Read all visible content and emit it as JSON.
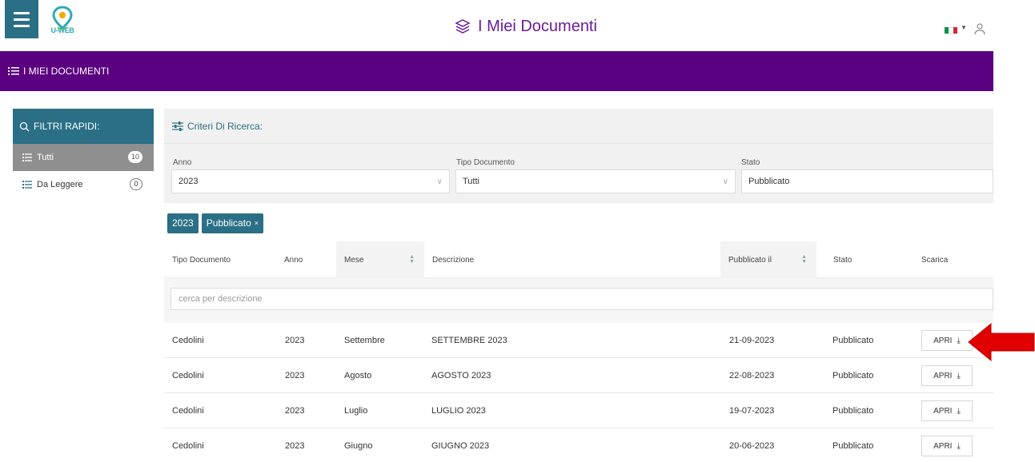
{
  "header": {
    "logo_text": "U-WEB",
    "title": "I Miei Documenti",
    "icons": [
      "menu-icon",
      "location-pin-icon",
      "layers-icon",
      "flag-italy-icon",
      "user-icon"
    ]
  },
  "band": {
    "label": "I MIEI DOCUMENTI"
  },
  "quick_filters": {
    "title": "FILTRI RAPIDI:",
    "items": [
      {
        "label": "Tutti",
        "count": "10"
      },
      {
        "label": "Da Leggere",
        "count": "0"
      }
    ]
  },
  "criteria": {
    "title": "Criteri Di Ricerca:",
    "anno": {
      "label": "Anno",
      "value": "2023"
    },
    "tipo": {
      "label": "Tipo Documento",
      "value": "Tutti"
    },
    "stato": {
      "label": "Stato",
      "value": "Pubblicato"
    }
  },
  "chips": [
    {
      "label": "2023"
    },
    {
      "label": "Pubblicato",
      "remove": "×"
    }
  ],
  "table": {
    "columns": [
      "Tipo Documento",
      "Anno",
      "Mese",
      "Descrizione",
      "Pubblicato il",
      "Stato",
      "Scarica"
    ],
    "search_placeholder": "cerca per descrizione",
    "rows": [
      {
        "tipo": "Cedolini",
        "anno": "2023",
        "mese": "Settembre",
        "descrizione": "SETTEMBRE 2023",
        "pubblicato": "21-09-2023",
        "stato": "Pubblicato",
        "azione": "APRI"
      },
      {
        "tipo": "Cedolini",
        "anno": "2023",
        "mese": "Agosto",
        "descrizione": "AGOSTO 2023",
        "pubblicato": "22-08-2023",
        "stato": "Pubblicato",
        "azione": "APRI"
      },
      {
        "tipo": "Cedolini",
        "anno": "2023",
        "mese": "Luglio",
        "descrizione": "LUGLIO 2023",
        "pubblicato": "19-07-2023",
        "stato": "Pubblicato",
        "azione": "APRI"
      },
      {
        "tipo": "Cedolini",
        "anno": "2023",
        "mese": "Giugno",
        "descrizione": "GIUGNO 2023",
        "pubblicato": "20-06-2023",
        "stato": "Pubblicato",
        "azione": "APRI"
      }
    ]
  },
  "colors": {
    "teal": "#2a6f85",
    "purple": "#5b0080",
    "arrow": "#e00000"
  }
}
